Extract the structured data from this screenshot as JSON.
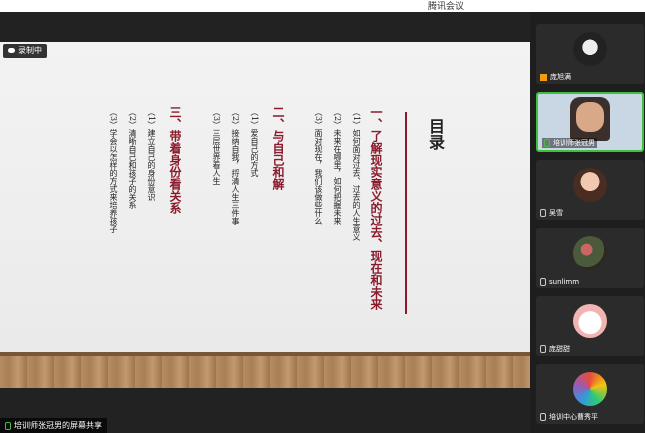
{
  "app": {
    "title": "腾讯会议"
  },
  "recording": {
    "label": "录制中"
  },
  "share": {
    "label": "培训师张冠男的屏幕共享"
  },
  "slide": {
    "title": "目录",
    "sections": [
      {
        "heading": "一、了解现实意义的过去、现在和未来",
        "items": [
          "（1）如何面对过去、过去的人生意义",
          "（2）未来在哪里，如何把握未来",
          "（3）面对现在，我们该做些什么"
        ]
      },
      {
        "heading": "二、与自己和解",
        "items": [
          "（1）爱自己的方式",
          "（2）接纳自我，捋清人生三件事",
          "（3）三层世界看人生"
        ]
      },
      {
        "heading": "三、带着身份看关系",
        "items": [
          "（1）建立自己的身份意识",
          "（2）清晰自己和孩子的关系",
          "（3）学会以怎样的方式来培养孩子"
        ]
      }
    ]
  },
  "participants": [
    {
      "name": "庞旭满"
    },
    {
      "name": "培训师张冠男"
    },
    {
      "name": "吴雪"
    },
    {
      "name": "sunlimm"
    },
    {
      "name": "庞甜甜"
    },
    {
      "name": "培训中心曹秀平"
    }
  ],
  "colors": {
    "accent": "#8a1a2c",
    "active_border": "#3ec23e"
  }
}
